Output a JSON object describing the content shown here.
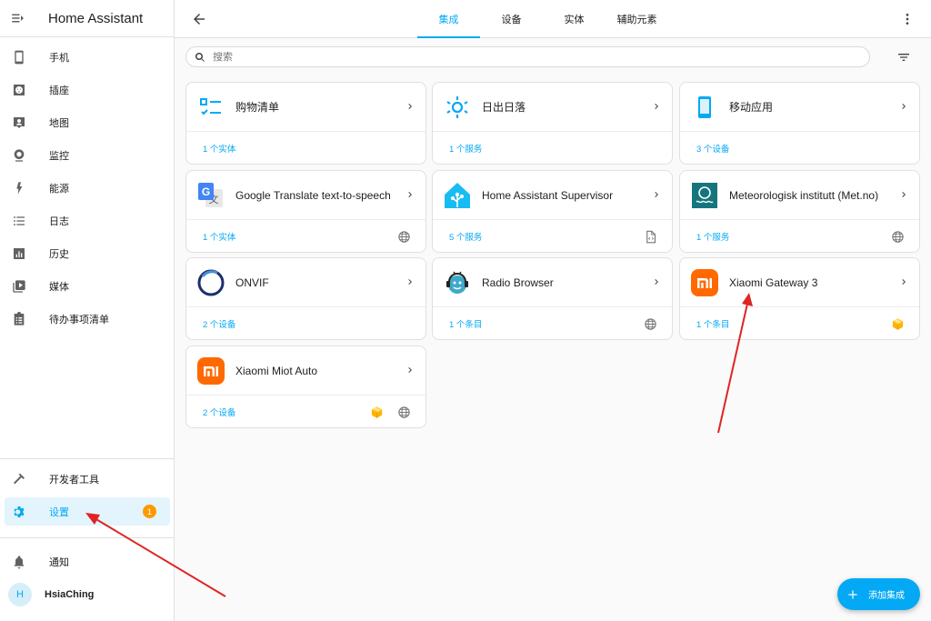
{
  "app": {
    "title": "Home Assistant"
  },
  "sidebar": {
    "items": [
      {
        "label": "手机",
        "icon": "phone-icon"
      },
      {
        "label": "插座",
        "icon": "socket-icon"
      },
      {
        "label": "地图",
        "icon": "map-icon"
      },
      {
        "label": "监控",
        "icon": "camera-icon"
      },
      {
        "label": "能源",
        "icon": "energy-icon"
      },
      {
        "label": "日志",
        "icon": "logbook-icon"
      },
      {
        "label": "历史",
        "icon": "history-icon"
      },
      {
        "label": "媒体",
        "icon": "media-icon"
      },
      {
        "label": "待办事项清单",
        "icon": "todo-icon"
      }
    ],
    "dev_tools": {
      "label": "开发者工具",
      "icon": "hammer-icon"
    },
    "settings": {
      "label": "设置",
      "icon": "gear-icon",
      "badge": "1",
      "active": true
    },
    "notifications": {
      "label": "通知",
      "icon": "bell-icon"
    },
    "user": {
      "initial": "H",
      "name": "HsiaChing"
    }
  },
  "header": {
    "tabs": [
      {
        "label": "集成",
        "active": true
      },
      {
        "label": "设备",
        "active": false
      },
      {
        "label": "实体",
        "active": false
      },
      {
        "label": "辅助元素",
        "active": false
      }
    ]
  },
  "search": {
    "placeholder": "搜索",
    "value": ""
  },
  "cards": [
    {
      "name": "购物清单",
      "link": "1 个实体",
      "logo": "shopping-list-icon",
      "icons": []
    },
    {
      "name": "日出日落",
      "link": "1 个服务",
      "logo": "sun-icon",
      "icons": []
    },
    {
      "name": "移动应用",
      "link": "3 个设备",
      "logo": "mobile-app-icon",
      "icons": []
    },
    {
      "name": "Google Translate text-to-speech",
      "link": "1 个实体",
      "logo": "google-translate-icon",
      "icons": [
        "globe-icon"
      ]
    },
    {
      "name": "Home Assistant Supervisor",
      "link": "5 个服务",
      "logo": "home-assistant-icon",
      "icons": [
        "file-code-icon"
      ]
    },
    {
      "name": "Meteorologisk institutt (Met.no)",
      "link": "1 个服务",
      "logo": "met-no-icon",
      "icons": [
        "globe-icon"
      ]
    },
    {
      "name": "ONVIF",
      "link": "2 个设备",
      "logo": "onvif-icon",
      "icons": []
    },
    {
      "name": "Radio Browser",
      "link": "1 个条目",
      "logo": "radio-browser-icon",
      "icons": [
        "globe-icon"
      ]
    },
    {
      "name": "Xiaomi Gateway 3",
      "link": "1 个条目",
      "logo": "xiaomi-icon",
      "icons": [
        "custom-integration-icon"
      ]
    },
    {
      "name": "Xiaomi Miot Auto",
      "link": "2 个设备",
      "logo": "xiaomi-icon",
      "icons": [
        "custom-integration-icon",
        "globe-icon"
      ]
    }
  ],
  "fab": {
    "label": "添加集成",
    "icon": "plus-icon"
  },
  "colors": {
    "accent": "#03a9f4",
    "badge": "#ff9800",
    "xiaomi": "#ff6900",
    "annotation": "#e02424"
  }
}
